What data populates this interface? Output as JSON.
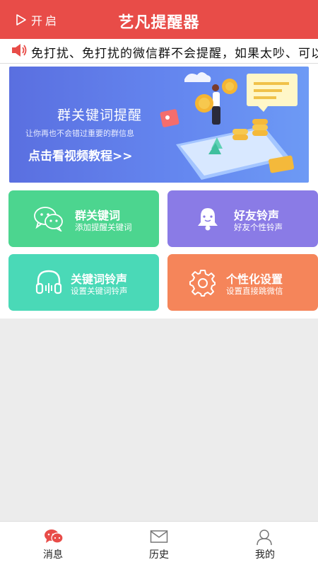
{
  "header": {
    "toggle_label": "开启",
    "title": "艺凡提醒器"
  },
  "notice": {
    "text": "免打扰、免打扰的微信群不会提醒，如果太吵、可以"
  },
  "banner": {
    "title": "群关键词提醒",
    "subtitle": "让你再也不会错过重要的群信息",
    "link": "点击看视频教程>>"
  },
  "cards": [
    {
      "title": "群关键词",
      "subtitle": "添加提醒关键词",
      "icon": "wechat-icon",
      "color": "#4cd58f"
    },
    {
      "title": "好友铃声",
      "subtitle": "好友个性铃声",
      "icon": "bell-icon",
      "color": "#8a7be6"
    },
    {
      "title": "关键词铃声",
      "subtitle": "设置关键词铃声",
      "icon": "headphones-icon",
      "color": "#4ad9b7"
    },
    {
      "title": "个性化设置",
      "subtitle": "设置直接跳微信",
      "icon": "gear-icon",
      "color": "#f5855a"
    }
  ],
  "tabs": [
    {
      "label": "消息",
      "icon": "message-icon",
      "active": true
    },
    {
      "label": "历史",
      "icon": "mail-icon",
      "active": false
    },
    {
      "label": "我的",
      "icon": "user-icon",
      "active": false
    }
  ],
  "colors": {
    "brand_red": "#e84c48",
    "background": "#ececec"
  }
}
